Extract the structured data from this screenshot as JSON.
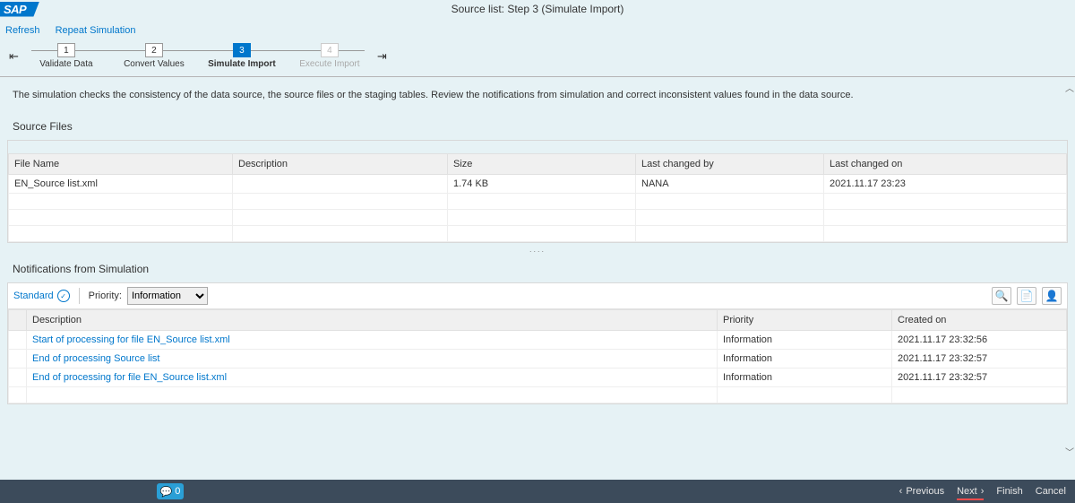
{
  "header": {
    "logo_text": "SAP",
    "page_title": "Source list: Step 3  (Simulate Import)"
  },
  "actions": {
    "refresh": "Refresh",
    "repeat": "Repeat Simulation"
  },
  "steps": [
    {
      "num": "1",
      "label": "Validate Data"
    },
    {
      "num": "2",
      "label": "Convert Values"
    },
    {
      "num": "3",
      "label": "Simulate Import"
    },
    {
      "num": "4",
      "label": "Execute Import"
    }
  ],
  "intro": "The simulation checks the consistency of the data source, the source files or the staging tables. Review the notifications from simulation and correct inconsistent values found in the data source.",
  "source_files": {
    "title": "Source Files",
    "columns": [
      "File Name",
      "Description",
      "Size",
      "Last changed by",
      "Last changed on"
    ],
    "rows": [
      {
        "file_name": "EN_Source list.xml",
        "description": "",
        "size": "1.74 KB",
        "last_changed_by": "NANA",
        "last_changed_on": "2021.11.17 23:23"
      }
    ]
  },
  "notifications": {
    "title": "Notifications from Simulation",
    "toolbar": {
      "standard": "Standard",
      "priority_label": "Priority:",
      "priority_value": "Information"
    },
    "columns": [
      "Description",
      "Priority",
      "Created on"
    ],
    "rows": [
      {
        "description": "Start of processing for file EN_Source list.xml",
        "priority": "Information",
        "created_on": "2021.11.17 23:32:56"
      },
      {
        "description": "End of processing Source list",
        "priority": "Information",
        "created_on": "2021.11.17 23:32:57"
      },
      {
        "description": "End of processing for file EN_Source list.xml",
        "priority": "Information",
        "created_on": "2021.11.17 23:32:57"
      }
    ]
  },
  "footer": {
    "msg_count": "0",
    "previous": "Previous",
    "next": "Next",
    "finish": "Finish",
    "cancel": "Cancel"
  }
}
